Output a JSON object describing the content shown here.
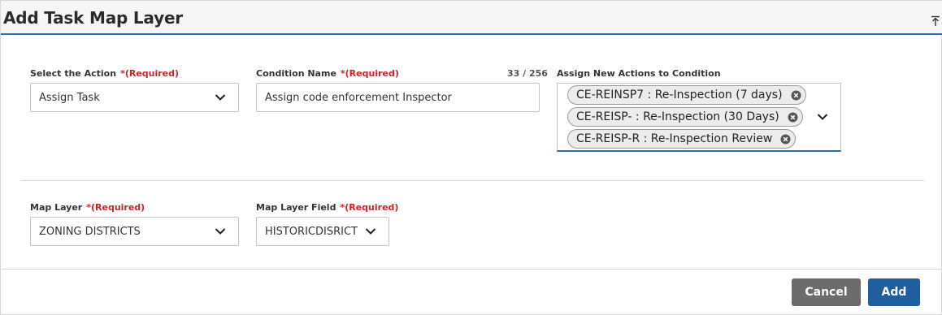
{
  "header": {
    "title": "Add Task Map Layer"
  },
  "required_text": "*(Required)",
  "action": {
    "label": "Select the Action",
    "value": "Assign Task"
  },
  "condition": {
    "label": "Condition Name",
    "counter": "33 / 256",
    "value": "Assign code enforcement Inspector"
  },
  "assign_actions": {
    "label": "Assign New Actions to Condition",
    "chips": [
      "CE-REINSP7 : Re-Inspection (7 days)",
      "CE-REISP- : Re-Inspection (30 Days)",
      "CE-REISP-R : Re-Inspection Review"
    ]
  },
  "map_layer": {
    "label": "Map Layer",
    "value": "ZONING DISTRICTS"
  },
  "map_layer_field": {
    "label": "Map Layer Field",
    "value": "HISTORICDISRICT"
  },
  "footer": {
    "cancel_label": "Cancel",
    "add_label": "Add"
  }
}
